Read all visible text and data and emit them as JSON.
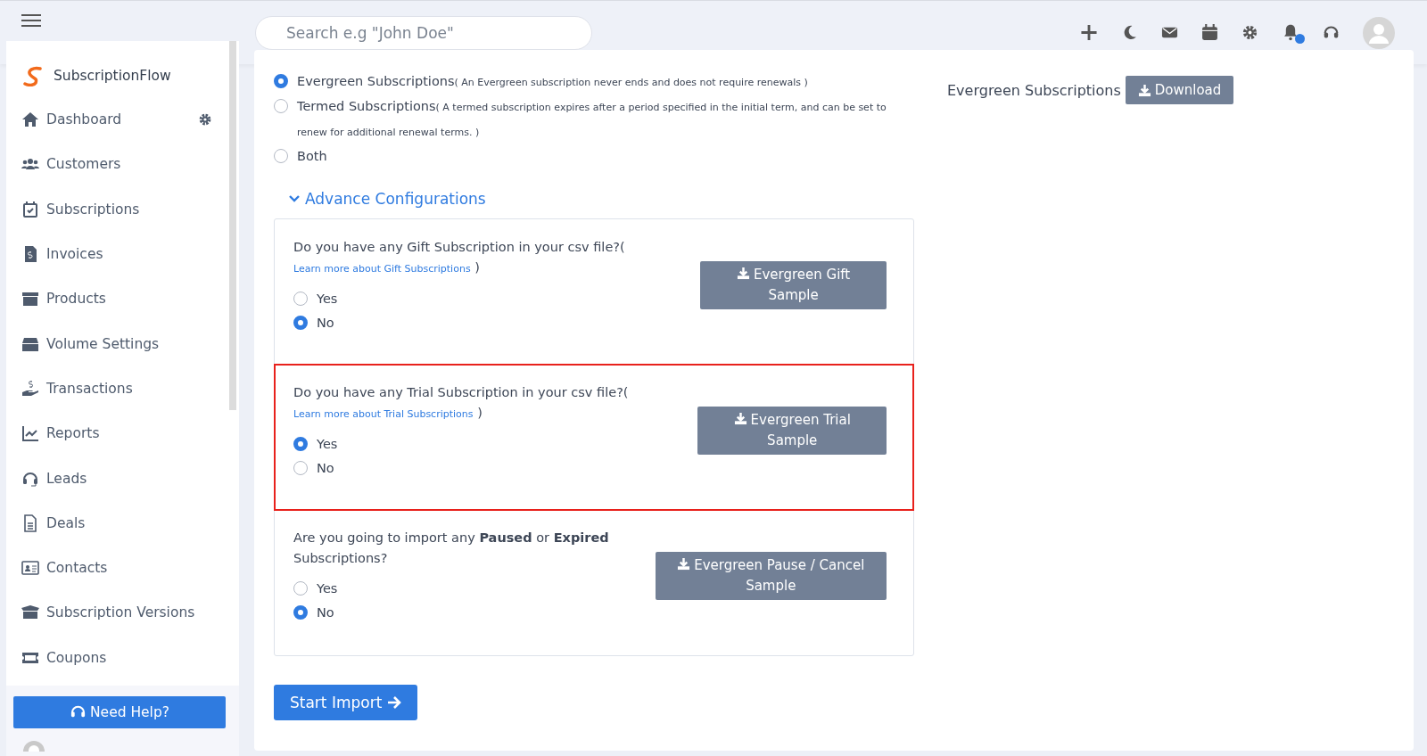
{
  "header": {
    "search": {
      "placeholder": "Search e.g \"John Doe\""
    },
    "notification_dot": true
  },
  "sidebar": {
    "brand": "SubscriptionFlow",
    "items": [
      {
        "label": "Dashboard",
        "settings": true
      },
      {
        "label": "Customers",
        "settings": false
      },
      {
        "label": "Subscriptions",
        "settings": false
      },
      {
        "label": "Invoices",
        "settings": false
      },
      {
        "label": "Products",
        "settings": false
      },
      {
        "label": "Volume Settings",
        "settings": false
      },
      {
        "label": "Transactions",
        "settings": false
      },
      {
        "label": "Reports",
        "settings": false
      },
      {
        "label": "Leads",
        "settings": false
      },
      {
        "label": "Deals",
        "settings": false
      },
      {
        "label": "Contacts",
        "settings": false
      },
      {
        "label": "Subscription Versions",
        "settings": false
      },
      {
        "label": "Coupons",
        "settings": false
      }
    ],
    "help_button": "Need Help?"
  },
  "subscription_types": [
    {
      "label": "Evergreen Subscriptions",
      "note": "( An Evergreen subscription never ends and does not require renewals )",
      "selected": true
    },
    {
      "label": "Termed Subscriptions",
      "note": "( A termed subscription expires after a period specified in the initial term, and can be set to renew for additional renewal terms. )",
      "selected": false
    },
    {
      "label": "Both",
      "selected": false
    }
  ],
  "advance_toggle": {
    "label": "Advance Configurations",
    "expanded": true
  },
  "questions": [
    {
      "prompt": "Do you have any Gift Subscription in your csv file?",
      "link_open": "(",
      "link": "Learn more about Gift Subscriptions",
      "link_close": ")",
      "highlighted": false,
      "options": [
        {
          "label": "Yes",
          "selected": false
        },
        {
          "label": "No",
          "selected": true
        }
      ],
      "sample_button": "Evergreen Gift Sample"
    },
    {
      "prompt": "Do you have any Trial Subscription in your csv file?",
      "link_open": "(",
      "link": "Learn more about Trial Subscriptions",
      "link_close": ")",
      "highlighted": true,
      "options": [
        {
          "label": "Yes",
          "selected": true
        },
        {
          "label": "No",
          "selected": false
        }
      ],
      "sample_button": "Evergreen Trial Sample"
    },
    {
      "prompt": "Are you going to import any **Paused** or **Expired** Subscriptions?",
      "highlighted": false,
      "options": [
        {
          "label": "Yes",
          "selected": false
        },
        {
          "label": "No",
          "selected": true
        }
      ],
      "sample_button": "Evergreen Pause / Cancel Sample"
    }
  ],
  "start_button": "Start Import",
  "samples": [
    {
      "label": "Evergreen Subscriptions",
      "button": "Download"
    }
  ]
}
